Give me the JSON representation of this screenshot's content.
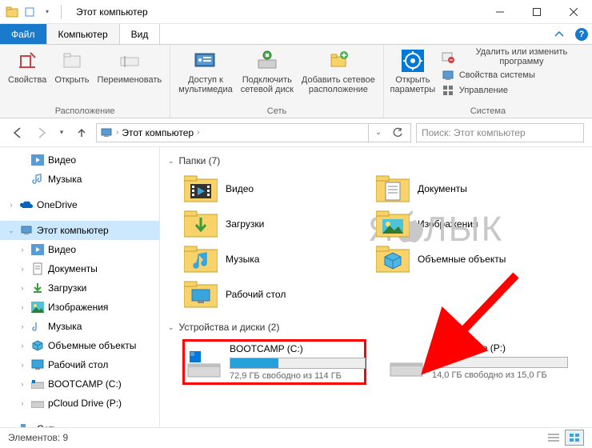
{
  "window": {
    "title": "Этот компьютер"
  },
  "tabs": {
    "file": "Файл",
    "computer": "Компьютер",
    "view": "Вид"
  },
  "ribbon": {
    "location": {
      "properties": "Свойства",
      "open": "Открыть",
      "rename": "Переименовать",
      "group": "Расположение"
    },
    "network": {
      "media": "Доступ к\nмультимедиа",
      "map": "Подключить\nсетевой диск",
      "addnet": "Добавить сетевое\nрасположение",
      "group": "Сеть"
    },
    "system": {
      "settings": "Открыть\nпараметры",
      "uninstall": "Удалить или изменить программу",
      "sysprops": "Свойства системы",
      "manage": "Управление",
      "group": "Система"
    }
  },
  "address": {
    "root": "Этот компьютер",
    "search_placeholder": "Поиск: Этот компьютер"
  },
  "tree": {
    "videos": "Видео",
    "music": "Музыка",
    "onedrive": "OneDrive",
    "thispc": "Этот компьютер",
    "downloads": "Загрузки",
    "pictures": "Изображения",
    "objects3d": "Объемные объекты",
    "desktop": "Рабочий стол",
    "bootcamp": "BOOTCAMP (C:)",
    "pcloud": "pCloud Drive (P:)",
    "network_root": "Сеть"
  },
  "main": {
    "folders_hdr": "Папки (7)",
    "folders": {
      "videos": "Видео",
      "documents": "Документы",
      "downloads": "Загрузки",
      "pictures": "Изображения",
      "music": "Музыка",
      "objects3d": "Объемные объекты",
      "desktop": "Рабочий стол"
    },
    "drives_hdr": "Устройства и диски (2)",
    "drives": [
      {
        "name": "BOOTCAMP (C:)",
        "free": "72,9 ГБ свободно из 114 ГБ",
        "used_pct": 36
      },
      {
        "name": "pCloud Drive (P:)",
        "free": "14,0 ГБ свободно из 15,0 ГБ",
        "used_pct": 7
      }
    ]
  },
  "status": {
    "count": "Элементов: 9"
  },
  "watermark": "ЯБЛЫК"
}
